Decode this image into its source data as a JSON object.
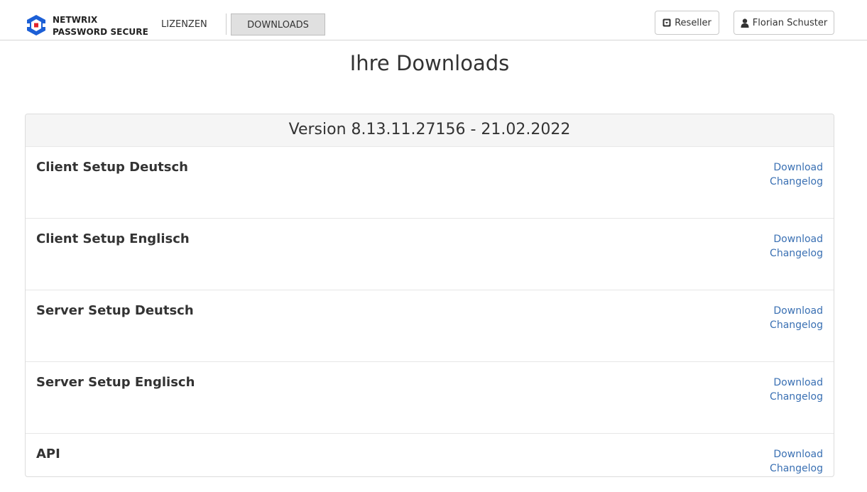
{
  "brand": {
    "line1": "NETWRIX",
    "line2": "PASSWORD SECURE"
  },
  "nav": {
    "lizenzen": "LIZENZEN",
    "downloads": "DOWNLOADS"
  },
  "header_buttons": {
    "reseller": "Reseller",
    "user": "Florian Schuster"
  },
  "colors": {
    "logo_blue": "#1c5fd6",
    "logo_red": "#e2242b",
    "link": "#3a70b3",
    "panel_header_bg": "#f5f5f5"
  },
  "page": {
    "title": "Ihre Downloads"
  },
  "version": {
    "label": "Version 8.13.11.27156 - 21.02.2022"
  },
  "items": [
    {
      "title": "Client Setup Deutsch",
      "download": "Download",
      "changelog": "Changelog"
    },
    {
      "title": "Client Setup Englisch",
      "download": "Download",
      "changelog": "Changelog"
    },
    {
      "title": "Server Setup Deutsch",
      "download": "Download",
      "changelog": "Changelog"
    },
    {
      "title": "Server Setup Englisch",
      "download": "Download",
      "changelog": "Changelog"
    },
    {
      "title": "API",
      "download": "Download",
      "changelog": "Changelog"
    }
  ]
}
